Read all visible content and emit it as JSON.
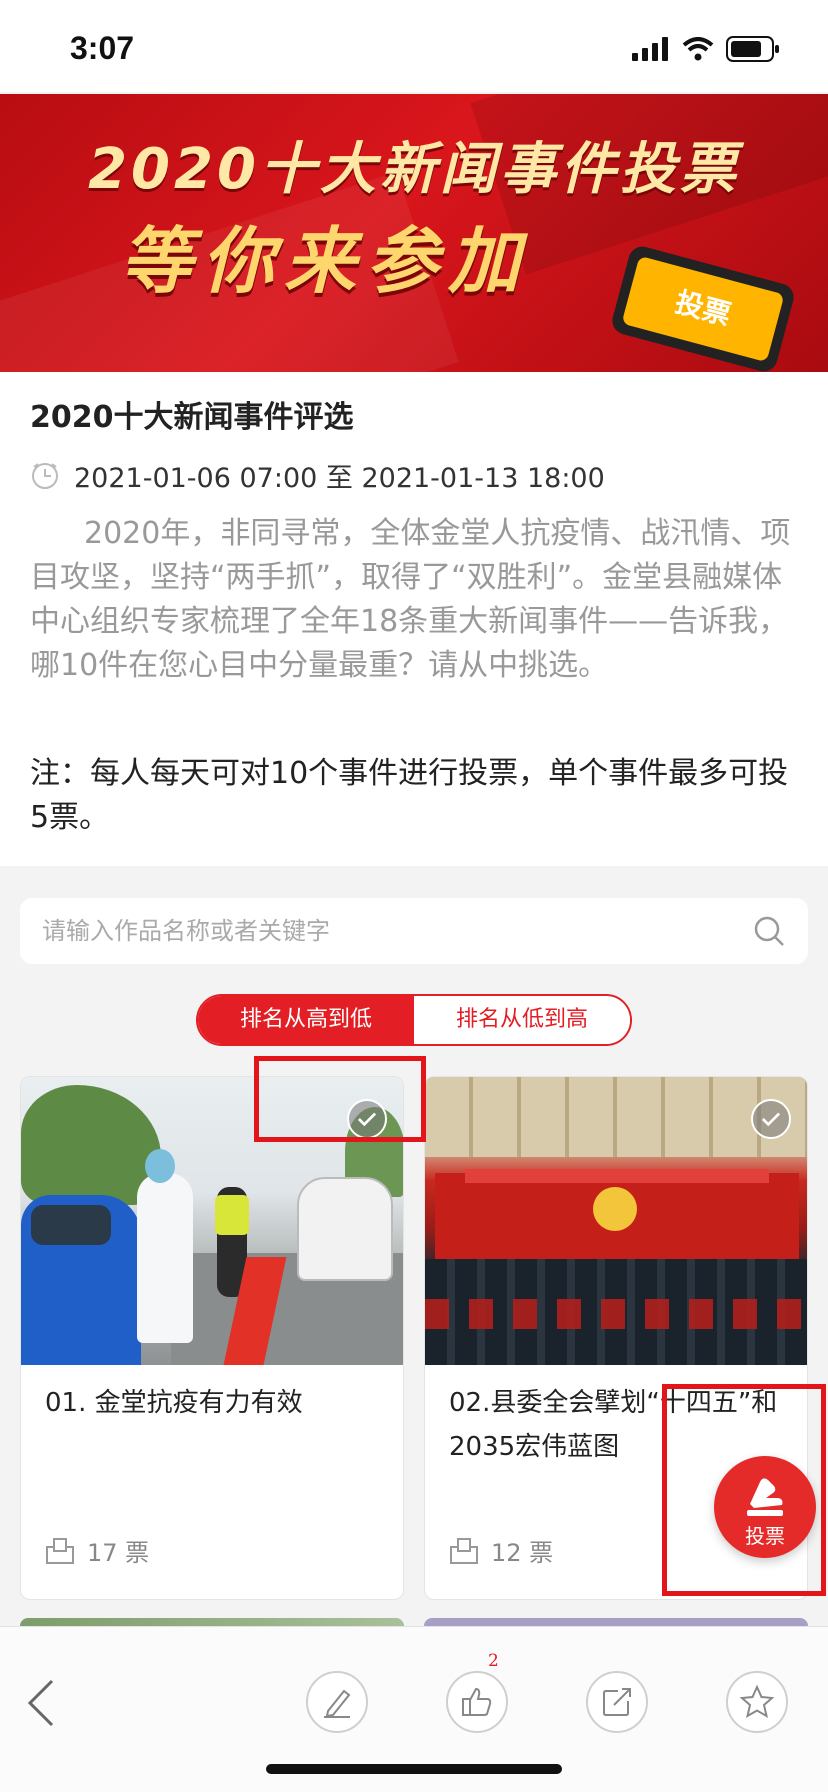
{
  "status_bar": {
    "time": "3:07"
  },
  "banner": {
    "line1": "2020十大新闻事件投票",
    "line2": "等你来参加",
    "phone_text": "投票"
  },
  "event": {
    "title": "2020十大新闻事件评选",
    "time_range": "2021-01-06 07:00 至 2021-01-13 18:00",
    "description": "2020年，非同寻常，全体金堂人抗疫情、战汛情、项目攻坚，坚持“两手抓”，取得了“双胜利”。金堂县融媒体中心组织专家梳理了全年18条重大新闻事件——告诉我，哪10件在您心目中分量最重？请从中挑选。",
    "note": "注：每人每天可对10个事件进行投票，单个事件最多可投5票。"
  },
  "search": {
    "placeholder": "请输入作品名称或者关键字",
    "value": ""
  },
  "sort": {
    "high_to_low": "排名从高到低",
    "low_to_high": "排名从低到高",
    "selected": "high_to_low"
  },
  "cards": [
    {
      "title": "01. 金堂抗疫有力有效",
      "votes": "17 票"
    },
    {
      "title": "02.县委全会擘划“十四五”和2035宏伟蓝图",
      "votes": "12 票"
    }
  ],
  "fab": {
    "label": "投票"
  },
  "bottom_bar": {
    "like_count": "2"
  },
  "colors": {
    "accent": "#e31e24",
    "highlight": "#e4141b",
    "banner_red": "#c8151b",
    "banner_gold": "#ffd66d"
  },
  "icons": [
    "signal-icon",
    "wifi-icon",
    "battery-icon",
    "clock-icon",
    "search-icon",
    "check-icon",
    "vote-count-icon",
    "vote-hand-icon",
    "back-icon",
    "pen-icon",
    "thumbs-up-icon",
    "share-icon",
    "star-icon"
  ]
}
